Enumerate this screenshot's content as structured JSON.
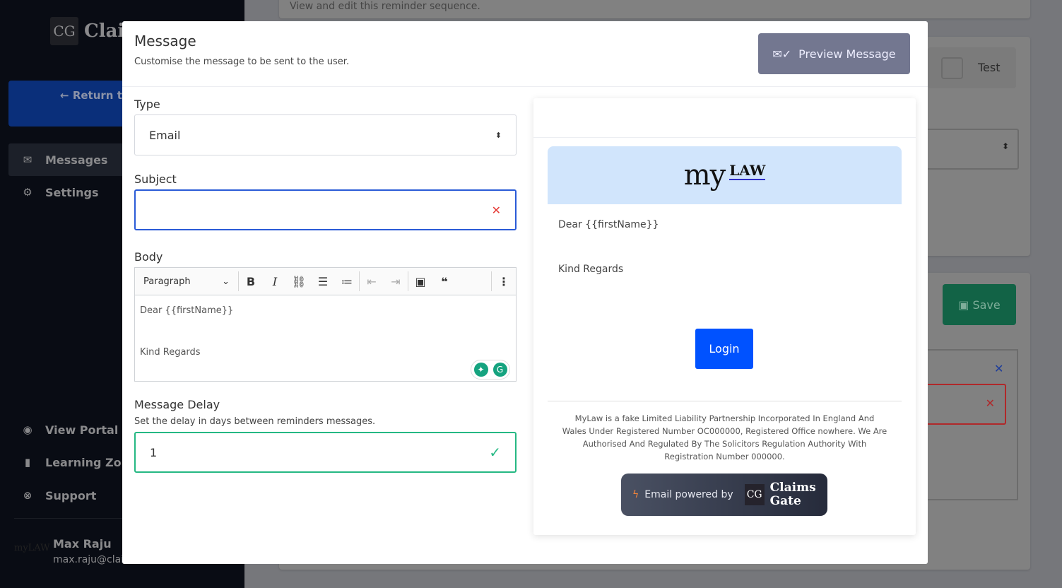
{
  "sidebar": {
    "logo_text": "Clai",
    "return_label": "← Return to Easy Cla",
    "items": [
      {
        "label": "Messages",
        "icon": "envelope-icon"
      },
      {
        "label": "Settings",
        "icon": "gear-icon"
      },
      {
        "label": "View Portal",
        "icon": "globe-icon"
      },
      {
        "label": "Learning Zone",
        "icon": "book-icon"
      },
      {
        "label": "Support",
        "icon": "lifebuoy-icon"
      }
    ],
    "user": {
      "logo": "myLAW",
      "name": "Max Raju",
      "email": "max.raju@clai"
    }
  },
  "background": {
    "subtitle": "View and edit this reminder sequence.",
    "test_label": "Test",
    "save_label": "Save"
  },
  "modal": {
    "title": "Message",
    "subtitle": "Customise the message to be sent to the user.",
    "preview_button": "Preview Message",
    "type_label": "Type",
    "type_value": "Email",
    "subject_label": "Subject",
    "subject_value": "",
    "body_label": "Body",
    "toolbar": {
      "paragraph": "Paragraph"
    },
    "body_lines": [
      "Dear {{firstName}}",
      "Kind Regards"
    ],
    "delay_label": "Message Delay",
    "delay_help": "Set the delay in days between reminders messages.",
    "delay_value": "1"
  },
  "preview": {
    "logo_my": "my",
    "logo_law": "LAW",
    "greeting": "Dear {{firstName}}",
    "signoff": "Kind Regards",
    "login_button": "Login",
    "footer": "MyLaw is a fake Limited Liability Partnership Incorporated In England And Wales Under Registered Number OC000000, Registered Office nowhere. We Are Authorised And Regulated By The Solicitors Regulation Authority With Registration Number 000000.",
    "powered_by": "Email powered by",
    "brand_line1": "Claims",
    "brand_line2": "Gate"
  },
  "colors": {
    "primary": "#0052ff",
    "valid": "#25b883",
    "error": "#e53935",
    "save": "#126346"
  }
}
